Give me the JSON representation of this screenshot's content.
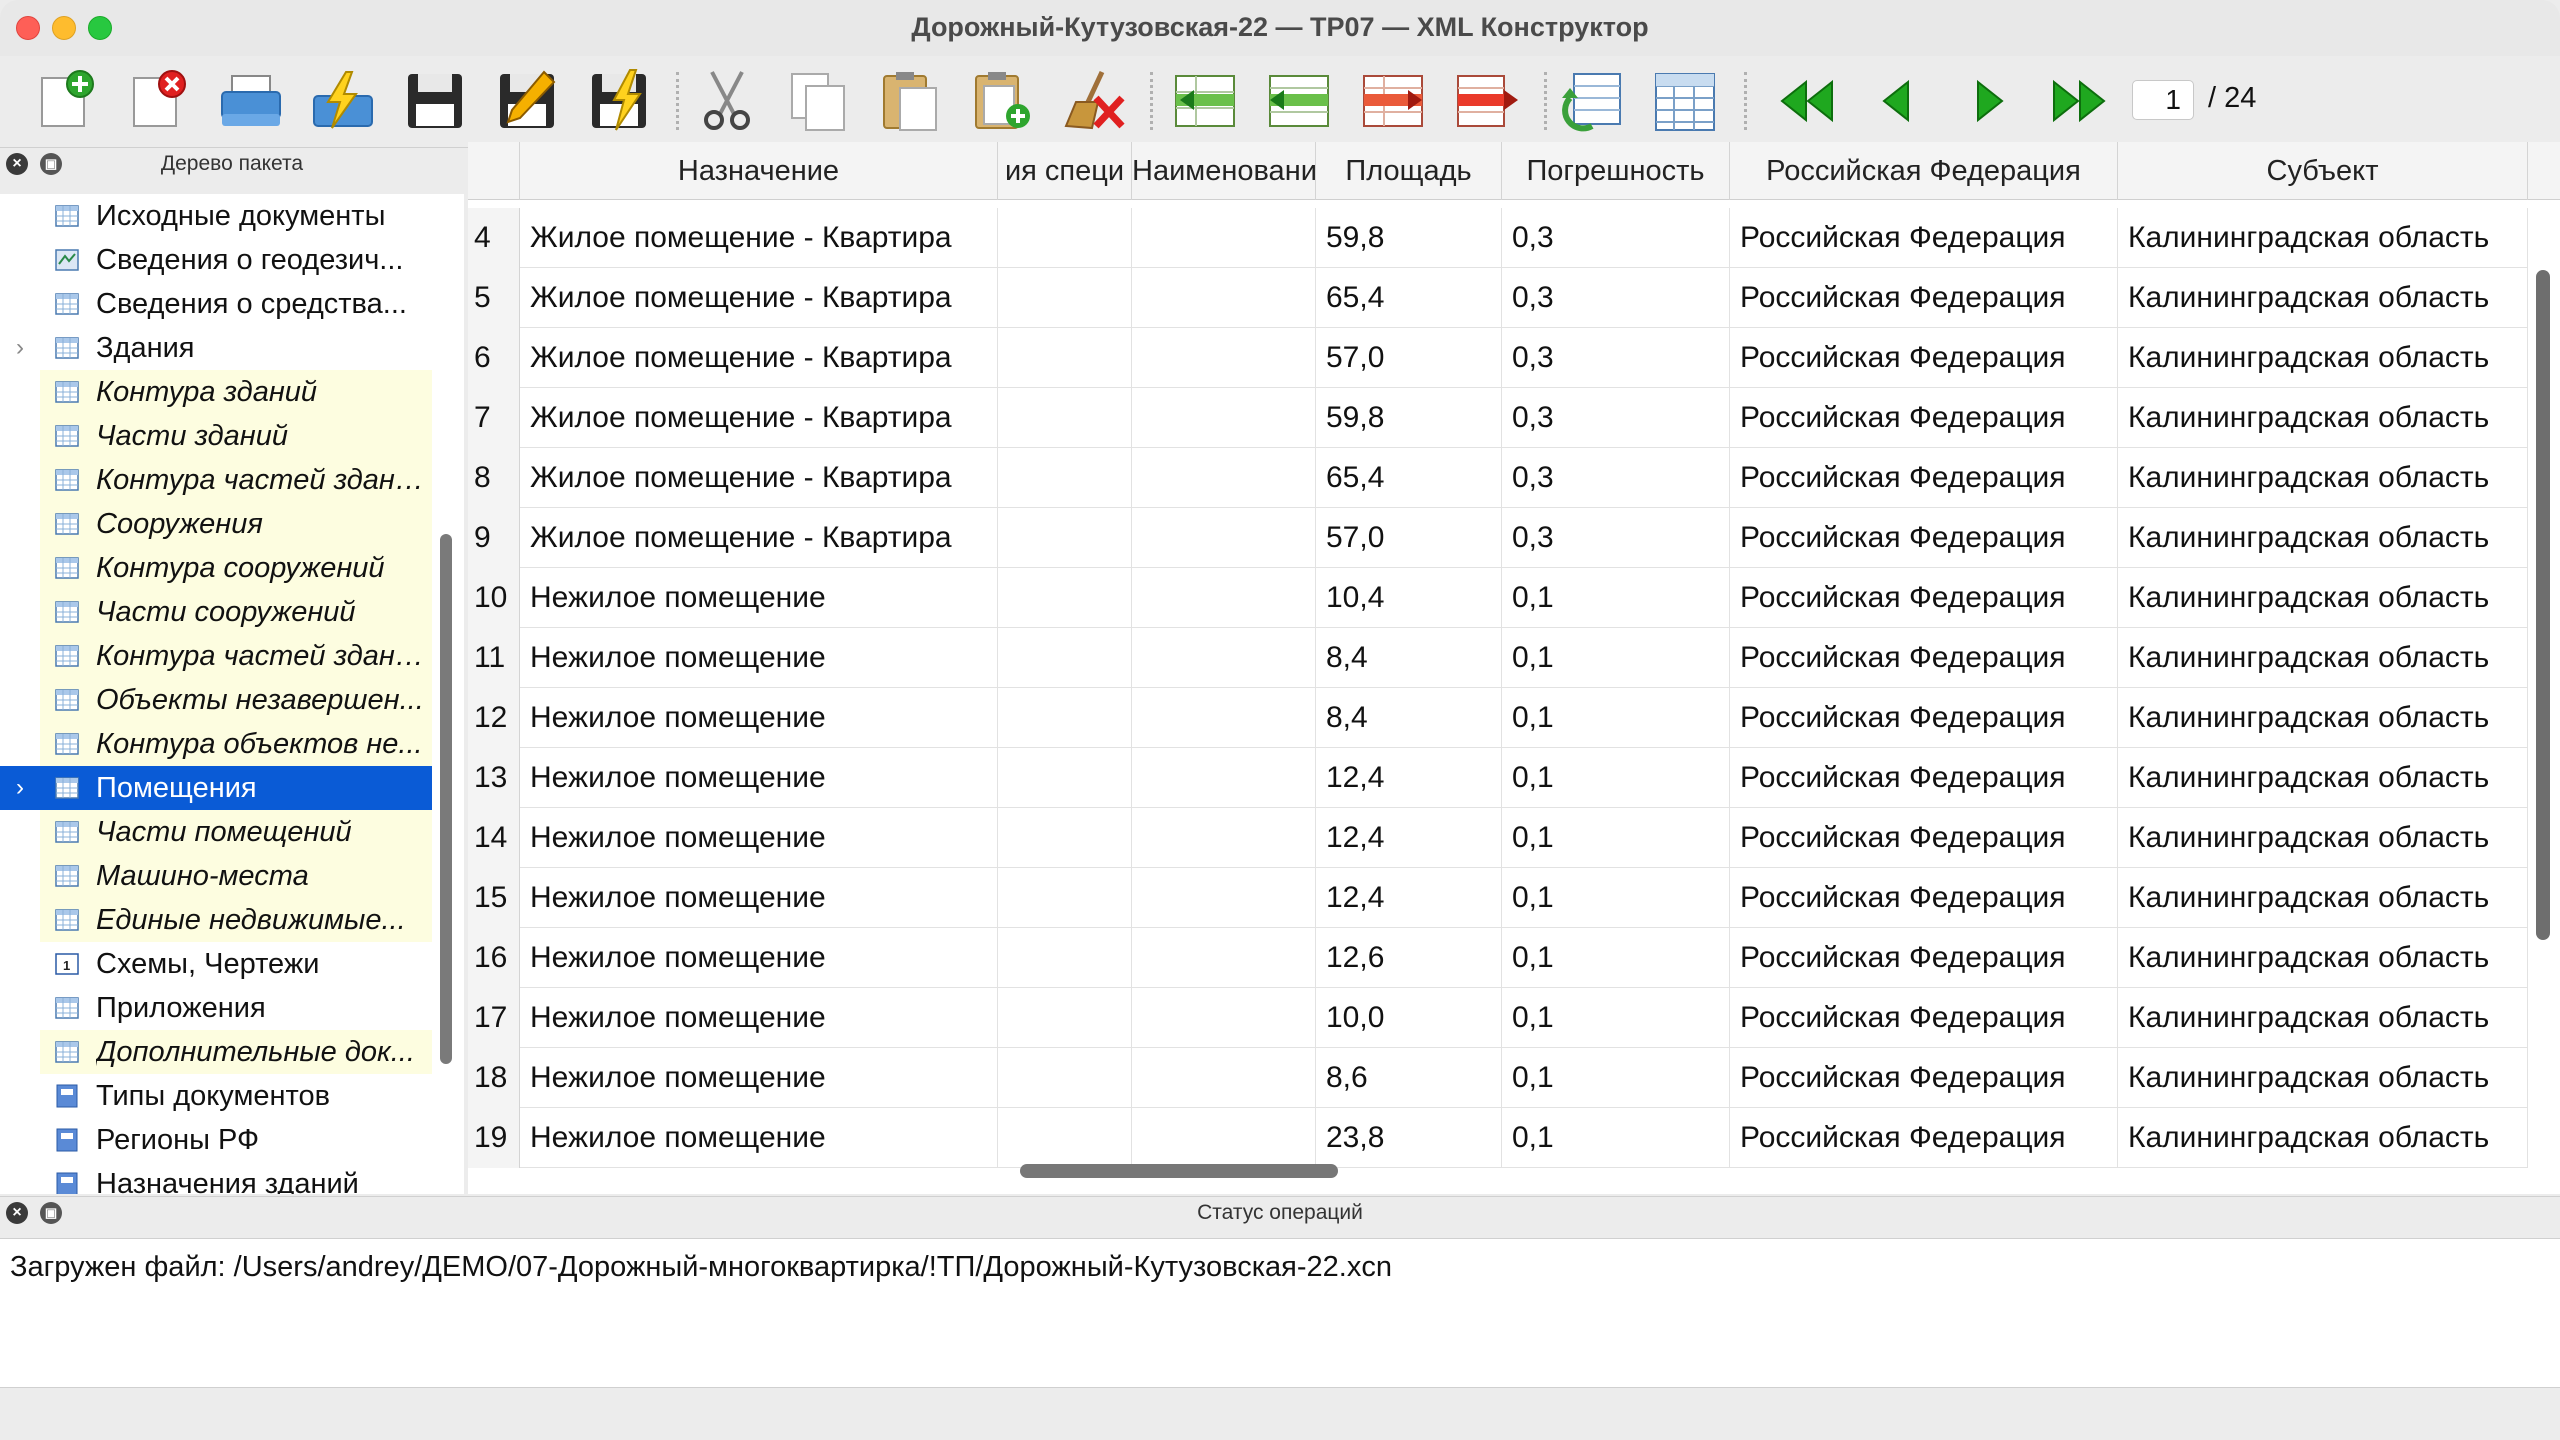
{
  "window": {
    "title": "Дорожный-Кутузовская-22 — ТР07 — XML Конструктор"
  },
  "toolbar": {
    "buttons": [
      "new-document",
      "close-document",
      "print",
      "validate",
      "save",
      "save-as",
      "save-signed",
      "cut",
      "copy",
      "paste",
      "paste-append",
      "clear",
      "insert-row-left",
      "insert-row",
      "add-row",
      "delete-row",
      "refresh",
      "table-view",
      "first-page",
      "prev-page",
      "next-page",
      "last-page"
    ],
    "page_current": "1",
    "page_total": "/ 24"
  },
  "tree_panel": {
    "title": "Дерево пакета",
    "items": [
      {
        "label": "Исходные документы",
        "style": "normal",
        "icon": "table-icon"
      },
      {
        "label": "Сведения о геодезич...",
        "style": "normal",
        "icon": "map-icon"
      },
      {
        "label": "Сведения о средства...",
        "style": "normal",
        "icon": "table-icon"
      },
      {
        "label": "Здания",
        "style": "normal",
        "icon": "table-icon",
        "expandable": true
      },
      {
        "label": "Контура зданий",
        "style": "yellow",
        "icon": "table-icon"
      },
      {
        "label": "Части зданий",
        "style": "yellow",
        "icon": "table-icon"
      },
      {
        "label": "Контура частей зданий",
        "style": "yellow",
        "icon": "table-icon"
      },
      {
        "label": "Сооружения",
        "style": "yellow",
        "icon": "table-icon"
      },
      {
        "label": "Контура сооружений",
        "style": "yellow",
        "icon": "table-icon"
      },
      {
        "label": "Части сооружений",
        "style": "yellow",
        "icon": "table-icon"
      },
      {
        "label": "Контура частей зданий",
        "style": "yellow",
        "icon": "table-icon"
      },
      {
        "label": "Объекты незавершен...",
        "style": "yellow",
        "icon": "table-icon"
      },
      {
        "label": "Контура объектов не...",
        "style": "yellow",
        "icon": "table-icon"
      },
      {
        "label": "Помещения",
        "style": "selected",
        "icon": "table-icon",
        "expandable": true
      },
      {
        "label": "Части помещений",
        "style": "yellow",
        "icon": "table-icon"
      },
      {
        "label": "Машино-места",
        "style": "yellow",
        "icon": "table-icon"
      },
      {
        "label": "Единые недвижимые...",
        "style": "yellow",
        "icon": "table-icon"
      },
      {
        "label": "Схемы, Чертежи",
        "style": "normal",
        "icon": "drawing-icon"
      },
      {
        "label": "Приложения",
        "style": "normal",
        "icon": "table-icon"
      },
      {
        "label": "Дополнительные док...",
        "style": "yellow",
        "icon": "table-icon"
      },
      {
        "label": "Типы документов",
        "style": "normal",
        "icon": "book-icon"
      },
      {
        "label": "Регионы РФ",
        "style": "normal",
        "icon": "book-icon"
      },
      {
        "label": "Назначения зданий",
        "style": "normal",
        "icon": "book-icon"
      }
    ]
  },
  "table": {
    "columns": [
      "",
      "Назначение",
      "ия специ",
      "Наименование",
      "Площадь",
      "Погрешность",
      "Российская Федерация",
      "Субъект"
    ],
    "rows": [
      [
        "4",
        "Жилое помещение - Квартира",
        "",
        "",
        "59,8",
        "0,3",
        "Российская Федерация",
        "Калининградская область"
      ],
      [
        "5",
        "Жилое помещение - Квартира",
        "",
        "",
        "65,4",
        "0,3",
        "Российская Федерация",
        "Калининградская область"
      ],
      [
        "6",
        "Жилое помещение - Квартира",
        "",
        "",
        "57,0",
        "0,3",
        "Российская Федерация",
        "Калининградская область"
      ],
      [
        "7",
        "Жилое помещение - Квартира",
        "",
        "",
        "59,8",
        "0,3",
        "Российская Федерация",
        "Калининградская область"
      ],
      [
        "8",
        "Жилое помещение - Квартира",
        "",
        "",
        "65,4",
        "0,3",
        "Российская Федерация",
        "Калининградская область"
      ],
      [
        "9",
        "Жилое помещение - Квартира",
        "",
        "",
        "57,0",
        "0,3",
        "Российская Федерация",
        "Калининградская область"
      ],
      [
        "10",
        "Нежилое помещение",
        "",
        "",
        "10,4",
        "0,1",
        "Российская Федерация",
        "Калининградская область"
      ],
      [
        "11",
        "Нежилое помещение",
        "",
        "",
        "8,4",
        "0,1",
        "Российская Федерация",
        "Калининградская область"
      ],
      [
        "12",
        "Нежилое помещение",
        "",
        "",
        "8,4",
        "0,1",
        "Российская Федерация",
        "Калининградская область"
      ],
      [
        "13",
        "Нежилое помещение",
        "",
        "",
        "12,4",
        "0,1",
        "Российская Федерация",
        "Калининградская область"
      ],
      [
        "14",
        "Нежилое помещение",
        "",
        "",
        "12,4",
        "0,1",
        "Российская Федерация",
        "Калининградская область"
      ],
      [
        "15",
        "Нежилое помещение",
        "",
        "",
        "12,4",
        "0,1",
        "Российская Федерация",
        "Калининградская область"
      ],
      [
        "16",
        "Нежилое помещение",
        "",
        "",
        "12,6",
        "0,1",
        "Российская Федерация",
        "Калининградская область"
      ],
      [
        "17",
        "Нежилое помещение",
        "",
        "",
        "10,0",
        "0,1",
        "Российская Федерация",
        "Калининградская область"
      ],
      [
        "18",
        "Нежилое помещение",
        "",
        "",
        "8,6",
        "0,1",
        "Российская Федерация",
        "Калининградская область"
      ],
      [
        "19",
        "Нежилое помещение",
        "",
        "",
        "23,8",
        "0,1",
        "Российская Федерация",
        "Калининградская область"
      ]
    ]
  },
  "status_panel": {
    "title": "Статус операций",
    "message": "Загружен файл: /Users/andrey/ДЕМО/07-Дорожный-многоквартирка/!ТП/Дорожный-Кутузовская-22.xcn"
  },
  "colors": {
    "selection": "#0a5bd6",
    "yellow_row": "#fdfde0",
    "nav_green": "#1fa81f"
  }
}
